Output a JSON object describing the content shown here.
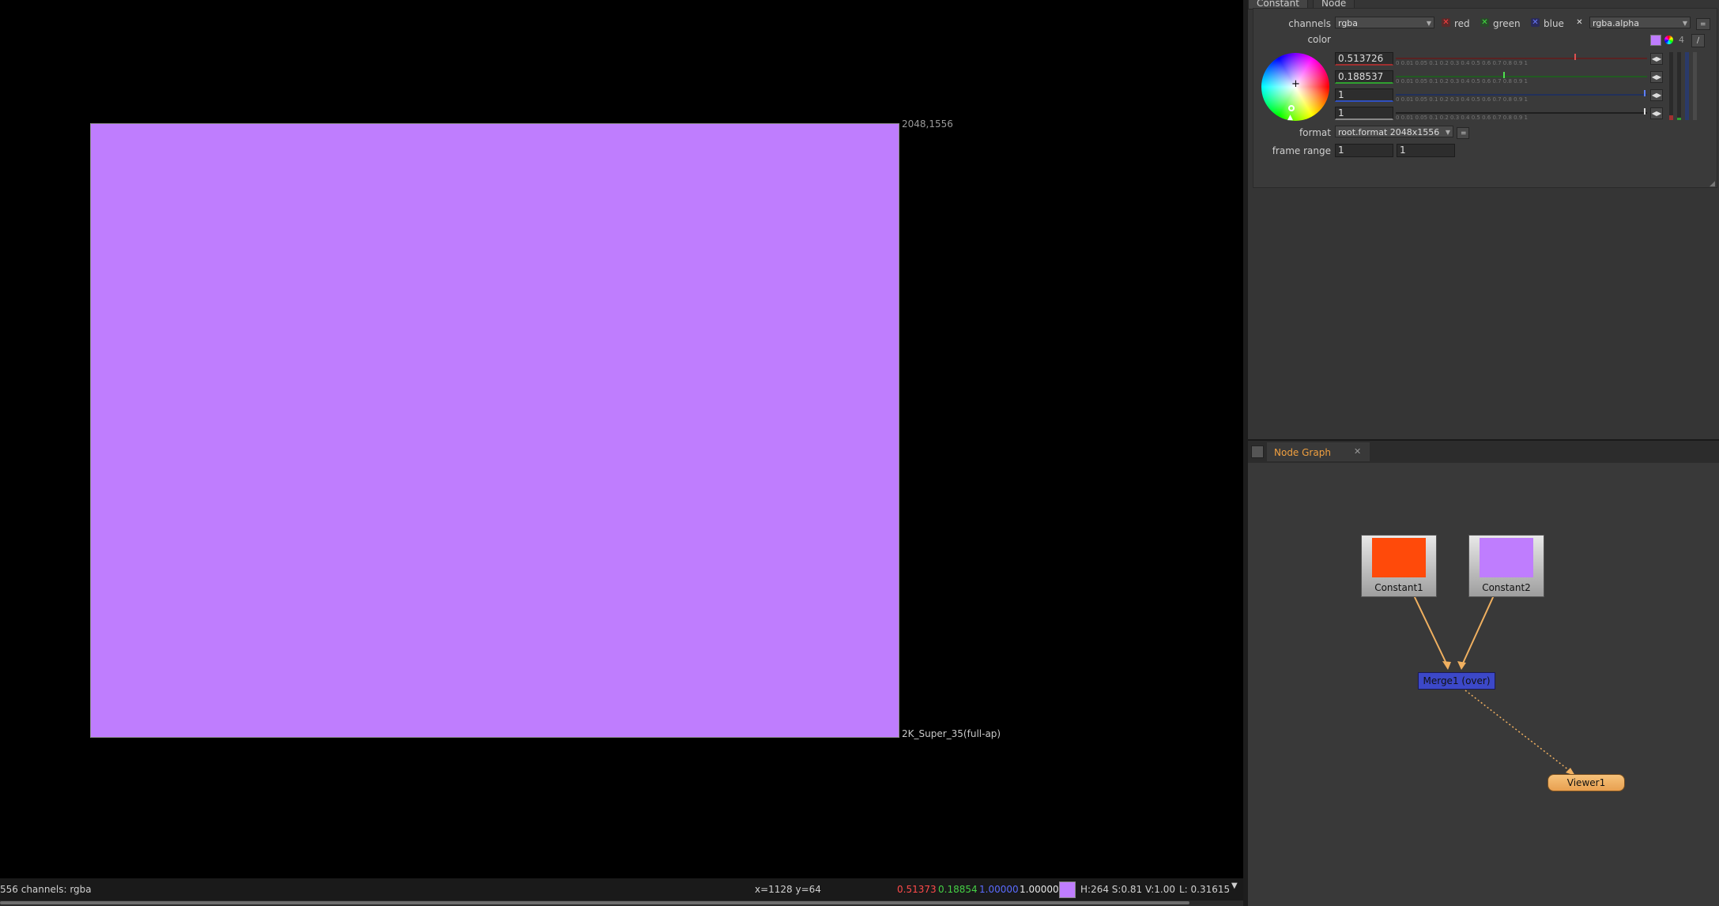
{
  "viewer": {
    "format_corner_label": "2048,1556",
    "format_name": "2K_Super_35(full-ap)",
    "frame_color": "#bf7dfe"
  },
  "status_bar": {
    "info": "556 channels: rgba",
    "coords": "x=1128 y=64",
    "r": "0.51373",
    "g": "0.18854",
    "b": "1.00000",
    "a": "1.00000",
    "swatch_color": "#bf7dfe",
    "hsv": "H:264 S:0.81 V:1.00",
    "luma": "L: 0.31615"
  },
  "properties": {
    "tabs": [
      "Constant",
      "Node"
    ],
    "channels_label": "channels",
    "channels_value": "rgba",
    "red_label": "red",
    "green_label": "green",
    "blue_label": "blue",
    "alpha_channel_value": "rgba.alpha",
    "color_label": "color",
    "color_values": [
      "0.513726",
      "0.188537",
      "1",
      "1"
    ],
    "slider_ticks": "0      0.01      0.05     0.1       0.2       0.3       0.4     0.5    0.6   0.7   0.8  0.9  1",
    "count_badge": "4",
    "format_label": "format",
    "format_value": "root.format 2048x1556",
    "frame_range_label": "frame range",
    "frame_range_start": "1",
    "frame_range_end": "1"
  },
  "node_graph": {
    "tab_label": "Node Graph",
    "nodes": {
      "constant1": {
        "label": "Constant1",
        "color": "#ff4a0a"
      },
      "constant2": {
        "label": "Constant2",
        "color": "#bf7dfe"
      },
      "merge": {
        "label": "Merge1 (over)"
      },
      "viewer": {
        "label": "Viewer1"
      }
    }
  }
}
